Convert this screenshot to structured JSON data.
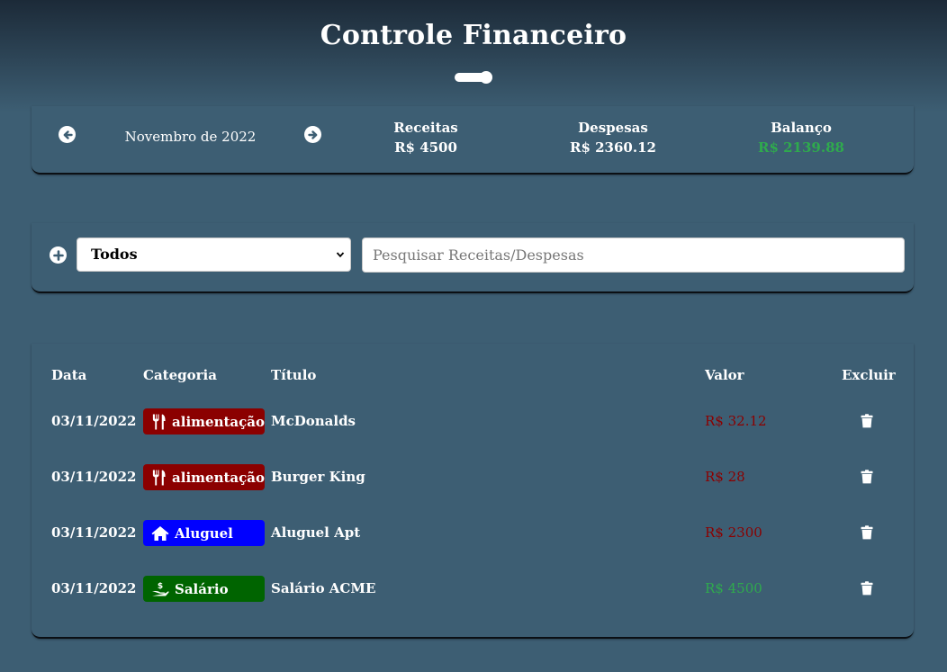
{
  "header": {
    "title": "Controle Financeiro",
    "theme_toggle_icon": "toggle-switch-icon"
  },
  "summary": {
    "prev_icon": "arrow-left-circle-icon",
    "next_icon": "arrow-right-circle-icon",
    "month": "Novembro de 2022",
    "receitas_label": "Receitas",
    "receitas_value": "R$ 4500",
    "despesas_label": "Despesas",
    "despesas_value": "R$ 2360.12",
    "balanco_label": "Balanço",
    "balanco_value": "R$ 2139.88",
    "balanco_color": "#2faa4d"
  },
  "filter": {
    "add_icon": "plus-circle-icon",
    "select_value": "Todos",
    "search_placeholder": "Pesquisar Receitas/Despesas"
  },
  "table": {
    "headers": [
      "Data",
      "Categoria",
      "Título",
      "Valor",
      "Excluir"
    ],
    "rows": [
      {
        "date": "03/11/2022",
        "category": "alimentação",
        "category_icon": "utensils-icon",
        "category_color": "#8b0000",
        "title": "McDonalds",
        "value": "R$ 32.12",
        "value_type": "expense",
        "delete_icon": "trash-icon"
      },
      {
        "date": "03/11/2022",
        "category": "alimentação",
        "category_icon": "utensils-icon",
        "category_color": "#8b0000",
        "title": "Burger King",
        "value": "R$ 28",
        "value_type": "expense",
        "delete_icon": "trash-icon"
      },
      {
        "date": "03/11/2022",
        "category": "Aluguel",
        "category_icon": "house-icon",
        "category_color": "#0000ff",
        "title": "Aluguel Apt",
        "value": "R$ 2300",
        "value_type": "expense",
        "delete_icon": "trash-icon"
      },
      {
        "date": "03/11/2022",
        "category": "Salário",
        "category_icon": "hand-money-icon",
        "category_color": "#006400",
        "title": "Salário ACME",
        "value": "R$ 4500",
        "value_type": "income",
        "delete_icon": "trash-icon"
      }
    ]
  },
  "colors": {
    "expense": "#8b0000",
    "income": "#2faa4d",
    "background": "#3d5e73"
  }
}
